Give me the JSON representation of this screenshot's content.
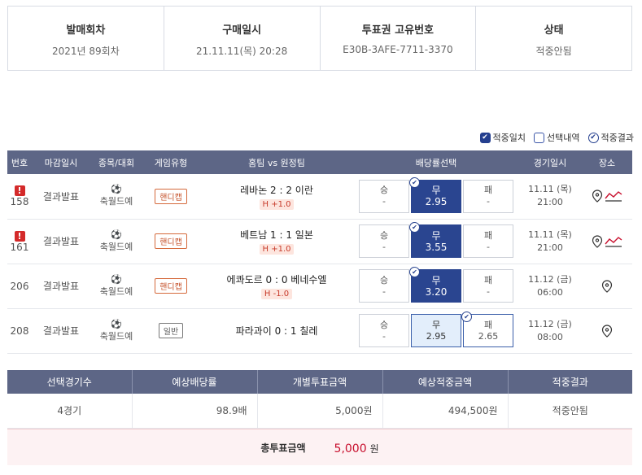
{
  "header": [
    {
      "label": "발매회차",
      "value": "2021년 89회차"
    },
    {
      "label": "구매일시",
      "value": "21.11.11(목) 20:28"
    },
    {
      "label": "투표권 고유번호",
      "value": "E30B-3AFE-7711-3370"
    },
    {
      "label": "상태",
      "value": "적중안됨"
    }
  ],
  "filters": [
    {
      "label": "적중일치",
      "state": "checked"
    },
    {
      "label": "선택내역",
      "state": "unchecked"
    },
    {
      "label": "적중결과",
      "state": "ring"
    }
  ],
  "table_headers": [
    "번호",
    "마감일시",
    "종목/대회",
    "게임유형",
    "홈팀 vs 원정팀",
    "배당률선택",
    "경기일시",
    "장소"
  ],
  "rows": [
    {
      "no": "158",
      "alert": true,
      "deadline": "결과발표",
      "sport": "축월드예",
      "type": "핸디캡",
      "match": "레바논 2 : 2 이란",
      "handicap": "H +1.0",
      "o1": {
        "label": "승",
        "value": "-"
      },
      "o2": {
        "label": "무",
        "value": "2.95"
      },
      "o3": {
        "label": "패",
        "value": "-"
      },
      "date": "11.11 (목)",
      "time": "21:00"
    },
    {
      "no": "161",
      "alert": true,
      "deadline": "결과발표",
      "sport": "축월드예",
      "type": "핸디캡",
      "match": "베트남 1 : 1 일본",
      "handicap": "H +1.0",
      "o1": {
        "label": "승",
        "value": "-"
      },
      "o2": {
        "label": "무",
        "value": "3.55"
      },
      "o3": {
        "label": "패",
        "value": "-"
      },
      "date": "11.11 (목)",
      "time": "21:00"
    },
    {
      "no": "206",
      "alert": false,
      "deadline": "결과발표",
      "sport": "축월드예",
      "type": "핸디캡",
      "match": "에콰도르 0 : 0 베네수엘",
      "handicap": "H -1.0",
      "o1": {
        "label": "승",
        "value": "-"
      },
      "o2": {
        "label": "무",
        "value": "3.20"
      },
      "o3": {
        "label": "패",
        "value": "-"
      },
      "date": "11.12 (금)",
      "time": "06:00"
    },
    {
      "no": "208",
      "alert": false,
      "deadline": "결과발표",
      "sport": "축월드예",
      "type": "일반",
      "match": "파라과이 0 : 1 칠레",
      "handicap": "",
      "o1": {
        "label": "승",
        "value": "-"
      },
      "o2": {
        "label": "무",
        "value": "2.95"
      },
      "o3": {
        "label": "패",
        "value": "2.65"
      },
      "date": "11.12 (금)",
      "time": "08:00"
    }
  ],
  "summary_headers": [
    "선택경기수",
    "예상배당률",
    "개별투표금액",
    "예상적중금액",
    "적중결과"
  ],
  "summary_values": [
    "4경기",
    "98.9배",
    "5,000원",
    "494,500원",
    "적중안됨"
  ],
  "total": {
    "label": "총투표금액",
    "amount": "5,000",
    "unit": "원"
  },
  "colors": {
    "header_bg": "#5d6686",
    "selected": "#2a4590",
    "alert": "#d42a2a",
    "total_amount": "#c8102e"
  }
}
